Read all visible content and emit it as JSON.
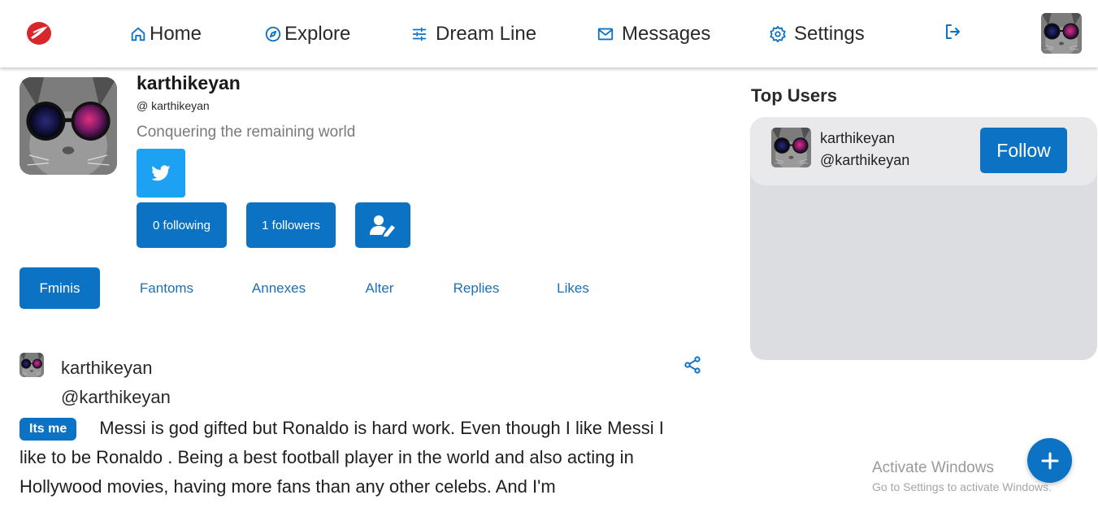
{
  "nav": {
    "logo_icon": "twitter-style-logo-icon",
    "items": [
      {
        "label": "Home",
        "icon": "home-icon"
      },
      {
        "label": "Explore",
        "icon": "compass-icon"
      },
      {
        "label": "Dream Line",
        "icon": "sliders-icon"
      },
      {
        "label": "Messages",
        "icon": "mail-icon"
      },
      {
        "label": "Settings",
        "icon": "gear-icon"
      }
    ],
    "logout_icon": "logout-icon",
    "avatar_icon": "cat-avatar"
  },
  "profile": {
    "name": "karthikeyan",
    "handle": "@ karthikeyan",
    "bio": "Conquering the remaining world",
    "following_label": "0 following",
    "followers_label": "1 followers"
  },
  "tabs": [
    {
      "label": "Fminis",
      "active": true
    },
    {
      "label": "Fantoms",
      "active": false
    },
    {
      "label": "Annexes",
      "active": false
    },
    {
      "label": "Alter",
      "active": false
    },
    {
      "label": "Replies",
      "active": false
    },
    {
      "label": "Likes",
      "active": false
    }
  ],
  "post": {
    "name": "karthikeyan",
    "handle": "@karthikeyan",
    "badge": "Its me",
    "text": "Messi is god gifted but Ronaldo is hard work. Even though I like Messi I like to be Ronaldo . Being a best football player in the world and also acting in Hollywood movies, having more fans than any other celebs. And I'm"
  },
  "top_users": {
    "title": "Top Users",
    "users": [
      {
        "name": "karthikeyan",
        "handle": "@karthikeyan",
        "button": "Follow"
      }
    ]
  },
  "watermark": {
    "title": "Activate Windows",
    "subtitle": "Go to Settings to activate Windows."
  },
  "colors": {
    "accent": "#0b72c4",
    "twitter": "#1da1f2",
    "panel": "#dcdde0",
    "logo_red": "#d8262b"
  }
}
